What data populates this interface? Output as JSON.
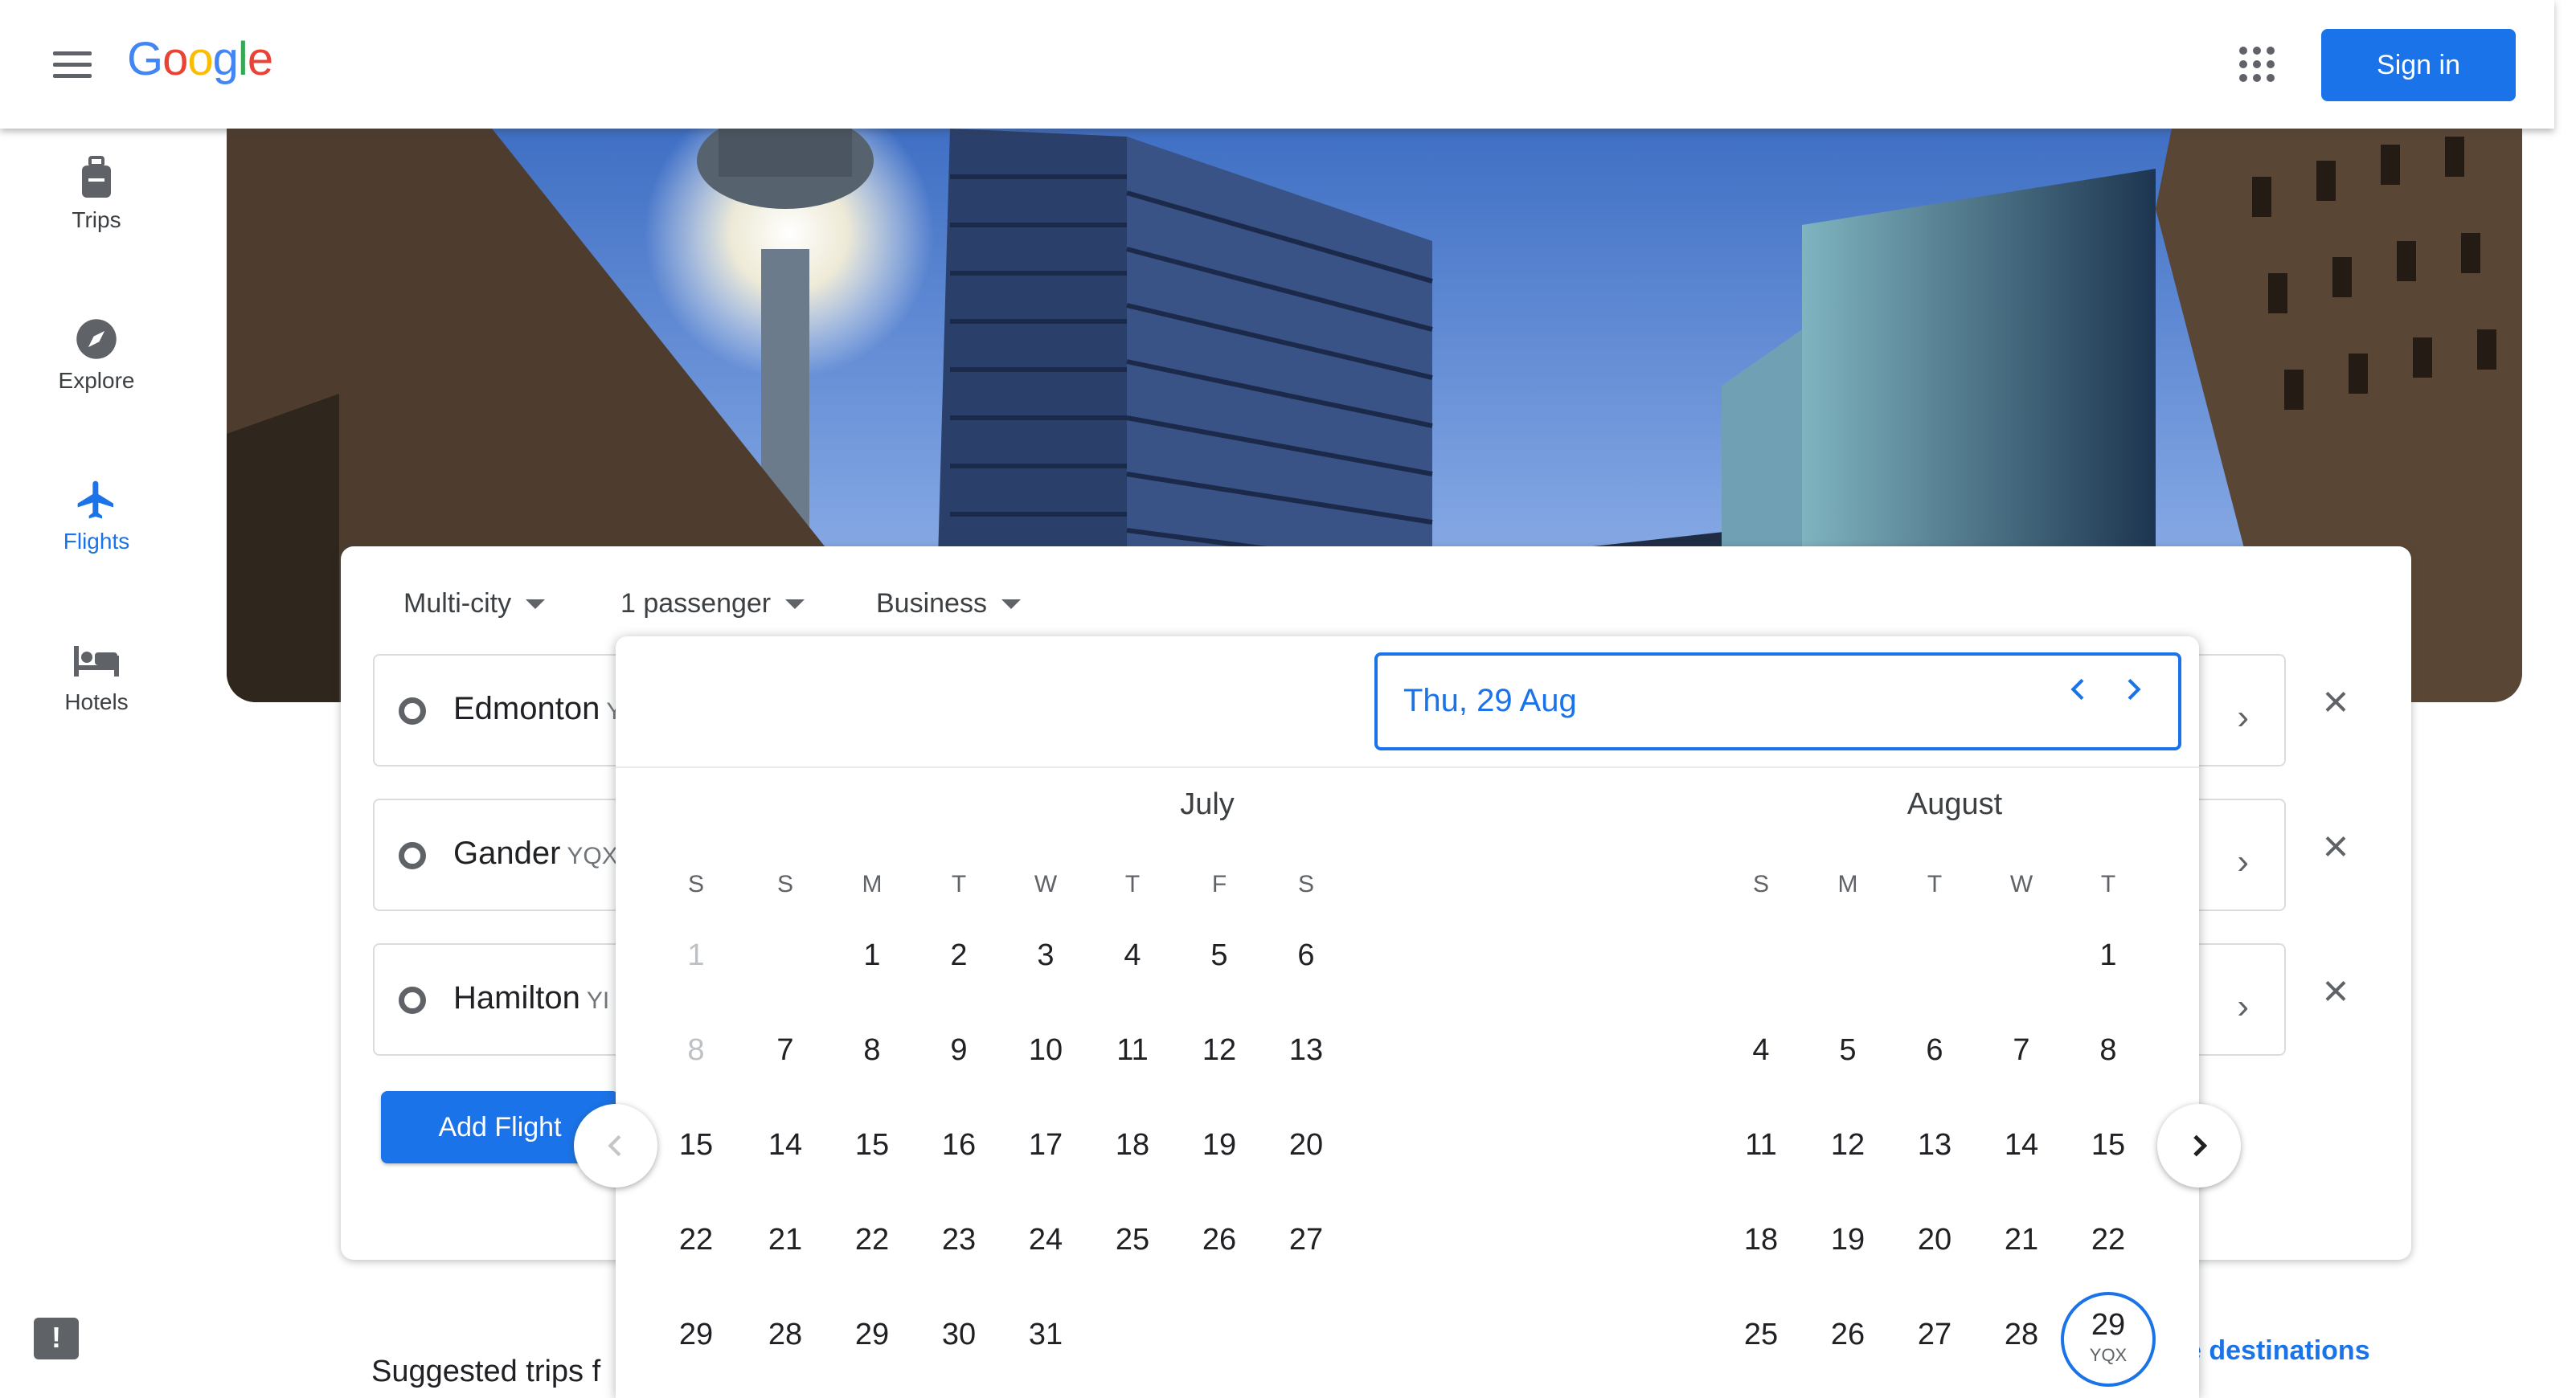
{
  "header": {
    "logo": "Google",
    "logo_colors": [
      "#4285F4",
      "#EA4335",
      "#FBBC05",
      "#4285F4",
      "#34A853",
      "#EA4335"
    ],
    "sign_in": "Sign in"
  },
  "sidenav": [
    {
      "label": "Trips",
      "icon": "luggage-icon",
      "active": false
    },
    {
      "label": "Explore",
      "icon": "compass-icon",
      "active": false
    },
    {
      "label": "Flights",
      "icon": "airplane-icon",
      "active": true
    },
    {
      "label": "Hotels",
      "icon": "bed-icon",
      "active": false
    }
  ],
  "search": {
    "trip_type": "Multi-city",
    "passengers": "1 passenger",
    "cabin": "Business",
    "legs": [
      {
        "city": "Edmonton",
        "code": "Y"
      },
      {
        "city": "Gander",
        "code": "YQX"
      },
      {
        "city": "Hamilton",
        "code": "YI"
      }
    ],
    "add_flight": "Add Flight"
  },
  "picker": {
    "selected_date": "Thu, 29 Aug",
    "weekdays": [
      "S",
      "M",
      "T",
      "W",
      "T",
      "F",
      "S"
    ],
    "left_partial": {
      "weekday": "S",
      "days": [
        "1",
        "8",
        "15",
        "22",
        "29"
      ]
    },
    "july": {
      "title": "July",
      "rows": [
        [
          "",
          "1",
          "2",
          "3",
          "4",
          "5",
          "6"
        ],
        [
          "7",
          "8",
          "9",
          "10",
          "11",
          "12",
          "13"
        ],
        [
          "14",
          "15",
          "16",
          "17",
          "18",
          "19",
          "20"
        ],
        [
          "21",
          "22",
          "23",
          "24",
          "25",
          "26",
          "27"
        ],
        [
          "28",
          "29",
          "30",
          "31",
          "",
          "",
          ""
        ]
      ]
    },
    "august": {
      "title": "August",
      "weekdays": [
        "S",
        "M",
        "T",
        "W",
        "T"
      ],
      "rows": [
        [
          "",
          "",
          "",
          "",
          "1"
        ],
        [
          "4",
          "5",
          "6",
          "7",
          "8"
        ],
        [
          "11",
          "12",
          "13",
          "14",
          "15"
        ],
        [
          "18",
          "19",
          "20",
          "21",
          "22"
        ],
        [
          "25",
          "26",
          "27",
          "28",
          "29"
        ]
      ],
      "selected_day": "29",
      "selected_sub": "YQX"
    }
  },
  "footer": {
    "suggested": "Suggested trips f",
    "destinations": "e destinations"
  },
  "colors": {
    "primary": "#1a73e8",
    "text": "#3c4043",
    "icon_grey": "#5f6368"
  }
}
